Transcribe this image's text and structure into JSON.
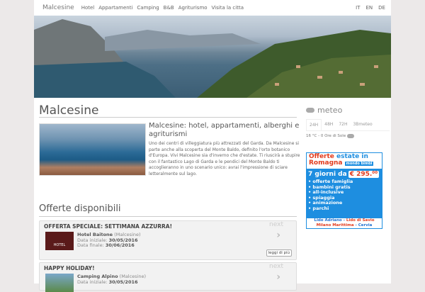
{
  "nav": {
    "brand": "Malcesine",
    "items": [
      "Hotel",
      "Appartamenti",
      "Camping",
      "B&B",
      "Agriturismo",
      "Visita la citta"
    ],
    "langs": [
      "IT",
      "EN",
      "DE"
    ]
  },
  "main": {
    "title": "Malcesine",
    "subtitle": "Malcesine: hotel, appartamenti, alberghi e agriturismi",
    "description": "Uno dei centri di villeggiatura più attrezzati del Garda. Da Malcesine si parte anche alla scoperta del Monte Baldo, definito l'orto botanico d'Europa. Vivi Malcesine sia d'inverno che d'estate. Ti riuscirà a stupire con il fantastico Lago di Garda e le pendici del Monte Baldo ti accoglieranno in uno scenario unico: avrai l'impressione di sciare letteralmente sul lago.",
    "offers_title": "Offerte disponibili"
  },
  "offers": [
    {
      "title": "OFFERTA SPECIALE: SETTIMANA AZZURRA!",
      "name": "Hotel Baitone",
      "place": "(Malcesine)",
      "start_label": "Data iniziale:",
      "start": "30/05/2016",
      "end_label": "Data finale:",
      "end": "30/06/2016",
      "next": "next",
      "more": "leggi di più",
      "img_label": "HOTEL"
    },
    {
      "title": "HAPPY HOLIDAY!",
      "name": "Camping Alpino",
      "place": "(Malcesine)",
      "start_label": "Data iniziale:",
      "start": "30/05/2016",
      "next": "next"
    }
  ],
  "meteo": {
    "title": "meteo",
    "tabs": [
      "24H",
      "48H",
      "72H",
      "3Bmeteo"
    ],
    "current": "16 °C - 0 Ore di Sole"
  },
  "ad": {
    "line1a": "Offerte",
    "line1b": "estate in",
    "line2": "Romagna",
    "tag": "mondo bimbi",
    "days": "7 giorni da",
    "price": "€ 295.⁰⁰",
    "bullets": [
      "• offerte famiglia",
      "• bambini gratis",
      "• all-inclusive",
      "• spiaggia",
      "• animazione",
      "• parchi"
    ],
    "places1a": "Lido Adriano",
    "places1b": "Lido di Savio",
    "places2a": "Milano Marittima",
    "places2b": "Cervia"
  }
}
